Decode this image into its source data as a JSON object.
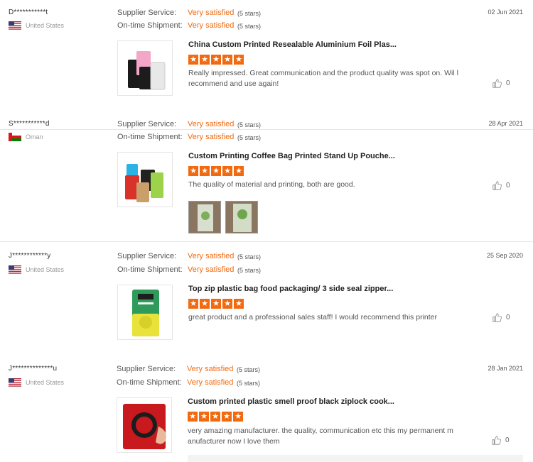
{
  "labels": {
    "supplier_service": "Supplier Service:",
    "ontime_shipment": "On-time Shipment:",
    "very_satisfied": "Very satisfied",
    "five_stars": "(5 stars)"
  },
  "reviews": [
    {
      "name": "D***********t",
      "country": "United States",
      "flag": "us",
      "date": "02 Jun 2021",
      "product_title": "China Custom Printed Resealable Aluminium Foil Plas...",
      "rating": 5,
      "text": "Really impressed. Great communication and the product quality was spot on. Wil l recommend and use again!",
      "likes": "0",
      "photos": 0
    },
    {
      "name": "S***********d",
      "country": "Oman",
      "flag": "om",
      "date": "28 Apr 2021",
      "product_title": "Custom Printing Coffee Bag Printed Stand Up Pouche...",
      "rating": 5,
      "text": "The quality of material and printing, both are good.",
      "likes": "0",
      "photos": 2
    },
    {
      "name": "J************y",
      "country": "United States",
      "flag": "us",
      "date": "25 Sep 2020",
      "product_title": "Top zip plastic bag food packaging/ 3 side seal zipper...",
      "rating": 5,
      "text": "great product and a professional sales staff! I would recommend  this printer",
      "likes": "0",
      "photos": 0
    },
    {
      "name": "J**************u",
      "country": "United States",
      "flag": "us",
      "date": "28 Jan 2021",
      "product_title": "Custom printed plastic smell proof black ziplock cook...",
      "rating": 5,
      "text": "very amazing manufacturer. the quality, communication etc this my permanent m anufacturer now I love them",
      "likes": "0",
      "photos": 0
    }
  ],
  "colors": {
    "accent": "#f26a10",
    "muted": "#999999",
    "divider": "#e6e6e6"
  },
  "icons": {
    "like": "thumbs-up-icon",
    "star": "star-icon"
  }
}
